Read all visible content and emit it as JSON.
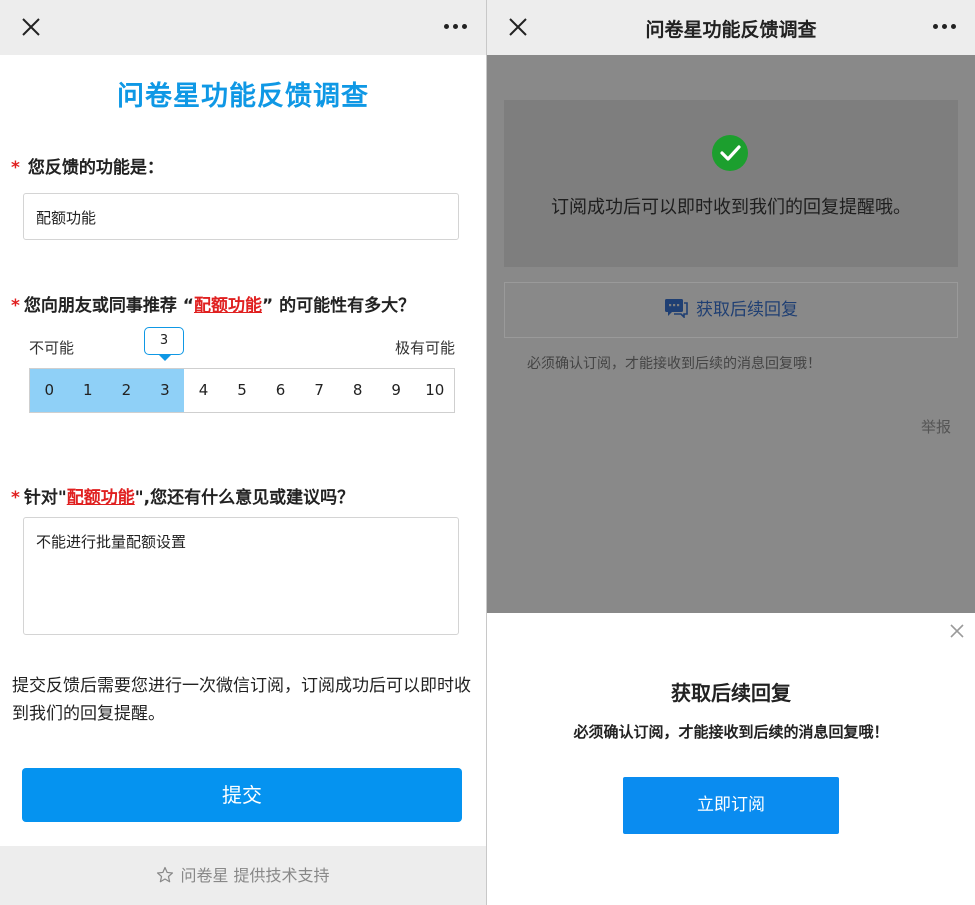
{
  "left": {
    "nav": {
      "close_icon": "close-icon",
      "more_icon": "more-icon"
    },
    "survey_title": "问卷星功能反馈调查",
    "q1": {
      "required": "*",
      "label": "您反馈的功能是：",
      "value": "配额功能"
    },
    "q2": {
      "required": "*",
      "label_prefix": "您向朋友或同事推荐 “",
      "highlight": "配额功能",
      "label_suffix": "” 的可能性有多大？",
      "low_label": "不可能",
      "high_label": "极有可能",
      "selected": "3",
      "options": [
        "0",
        "1",
        "2",
        "3",
        "4",
        "5",
        "6",
        "7",
        "8",
        "9",
        "10"
      ]
    },
    "q3": {
      "required": "*",
      "label_prefix": "针对\"",
      "highlight": "配额功能",
      "label_suffix": "\",您还有什么意见或建议吗？",
      "value": "不能进行批量配额设置"
    },
    "note": "提交反馈后需要您进行一次微信订阅，订阅成功后可以即时收到我们的回复提醒。",
    "submit_label": "提交",
    "footer": {
      "icon": "star-icon",
      "brand": "问卷星",
      "text": "提供技术支持"
    }
  },
  "right": {
    "nav": {
      "title": "问卷星功能反馈调查",
      "close_icon": "close-icon",
      "more_icon": "more-icon"
    },
    "success_text": "订阅成功后可以即时收到我们的回复提醒哦。",
    "get_reply_label": "获取后续回复",
    "must_confirm": "必须确认订阅，才能接收到后续的消息回复哦！",
    "report_label": "举报",
    "sheet": {
      "title": "获取后续回复",
      "text": "必须确认订阅，才能接收到后续的消息回复哦！",
      "button_label": "立即订阅"
    }
  },
  "colors": {
    "accent": "#0f98e5",
    "button": "#0593f0",
    "required": "#e02020",
    "success": "#1c9f2e",
    "scale_selected": "#8fd0f7"
  }
}
